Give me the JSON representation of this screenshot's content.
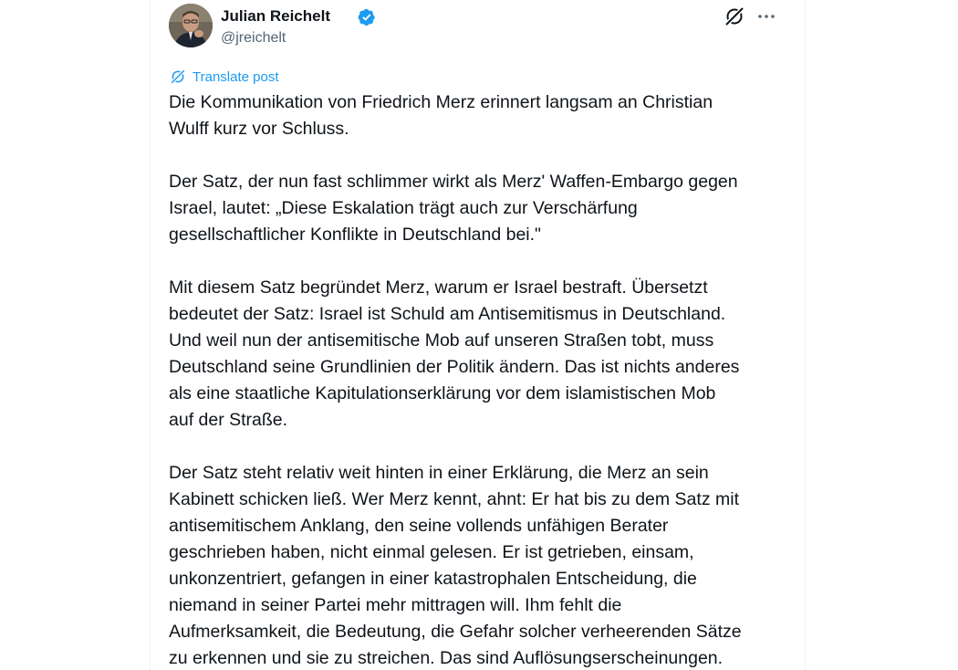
{
  "author": {
    "name": "Julian Reichelt",
    "handle": "@jreichelt",
    "verified": true
  },
  "translate_label": "Translate post",
  "post": {
    "paragraphs": [
      "Die Kommunikation von Friedrich Merz erinnert langsam an Christian\nWulff kurz vor Schluss.",
      "Der Satz, der nun fast schlimmer wirkt als Merz' Waffen-Embargo gegen\nIsrael, lautet: „Diese Eskalation trägt auch zur Verschärfung\ngesellschaftlicher Konflikte in Deutschland bei.\"",
      "Mit diesem Satz begründet Merz, warum er Israel bestraft. Übersetzt\nbedeutet der Satz: Israel ist Schuld am Antisemitismus in Deutschland.\nUnd weil nun der antisemitische Mob auf unseren Straßen tobt, muss\nDeutschland seine Grundlinien der Politik ändern. Das ist nichts anderes\nals eine staatliche Kapitulationserklärung vor dem islamistischen Mob\nauf der Straße.",
      "Der Satz steht relativ weit hinten in einer Erklärung, die Merz an sein\nKabinett schicken ließ. Wer Merz kennt, ahnt: Er hat bis zu dem Satz mit\nantisemitischem Anklang, den seine vollends unfähigen Berater\ngeschrieben haben, nicht einmal gelesen. Er ist getrieben, einsam,\nunkonzentriert, gefangen in einer katastrophalen Entscheidung, die\nniemand in seiner Partei mehr mittragen will. Ihm fehlt die\nAufmerksamkeit, die Bedeutung, die Gefahr solcher verheerenden Sätze\nzu erkennen und sie zu streichen. Das sind Auflösungserscheinungen."
    ]
  },
  "colors": {
    "text": "#0f1419",
    "secondary": "#536471",
    "accent": "#1d9bf0",
    "border": "#eff3f4"
  },
  "icons": {
    "verified": "verified-badge-icon",
    "grok": "grok-icon",
    "more": "more-icon",
    "translate": "translate-icon"
  }
}
